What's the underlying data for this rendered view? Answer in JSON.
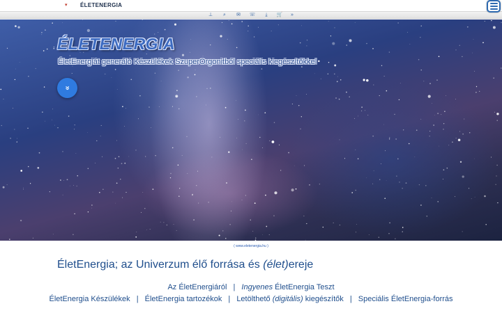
{
  "header": {
    "brand_caret": "▾",
    "brand_name": "ÉLETENERGIA",
    "menu_icon": "hamburger-menu-icon"
  },
  "iconbar": {
    "icons": [
      {
        "name": "sitemap-icon",
        "glyph": "⊥"
      },
      {
        "name": "search-icon",
        "glyph": "⌕"
      },
      {
        "name": "mail-icon",
        "glyph": "✉"
      },
      {
        "name": "phone-icon",
        "glyph": "☏"
      },
      {
        "name": "download-icon",
        "glyph": "⤓"
      },
      {
        "name": "cart-icon",
        "glyph": "🛒"
      },
      {
        "name": "more-icon",
        "glyph": "»"
      }
    ]
  },
  "hero": {
    "title": "ÉLETENERGIA",
    "subtitle": "ÉletEnergiát generáló Készülékek SzuperOrgonitból speciális kiegészítőkkel",
    "scroll_glyph": "»"
  },
  "caption": "( www.eletenergia.hu )",
  "headline": {
    "before": "ÉletEnergia; az Univerzum élő forrása és ",
    "emph": "(élet)",
    "after": "ereje"
  },
  "links_row1": {
    "about": "Az ÉletEnergiáról",
    "sep": "|",
    "test_emph": "Ingyenes",
    "test_rest": " ÉletEnergia Teszt"
  },
  "links_row2": {
    "devices": "ÉletEnergia Készülékek",
    "accessories": "ÉletEnergia tartozékok",
    "download_a": "Letölthető ",
    "download_emph": "(digitális)",
    "download_b": " kiegészítők",
    "special": "Speciális ÉletEnergia-forrás",
    "sep": "|"
  },
  "colors": {
    "brand_blue": "#1f4e8c",
    "button_blue": "#2f7be0",
    "accent_red": "#c0392b"
  }
}
